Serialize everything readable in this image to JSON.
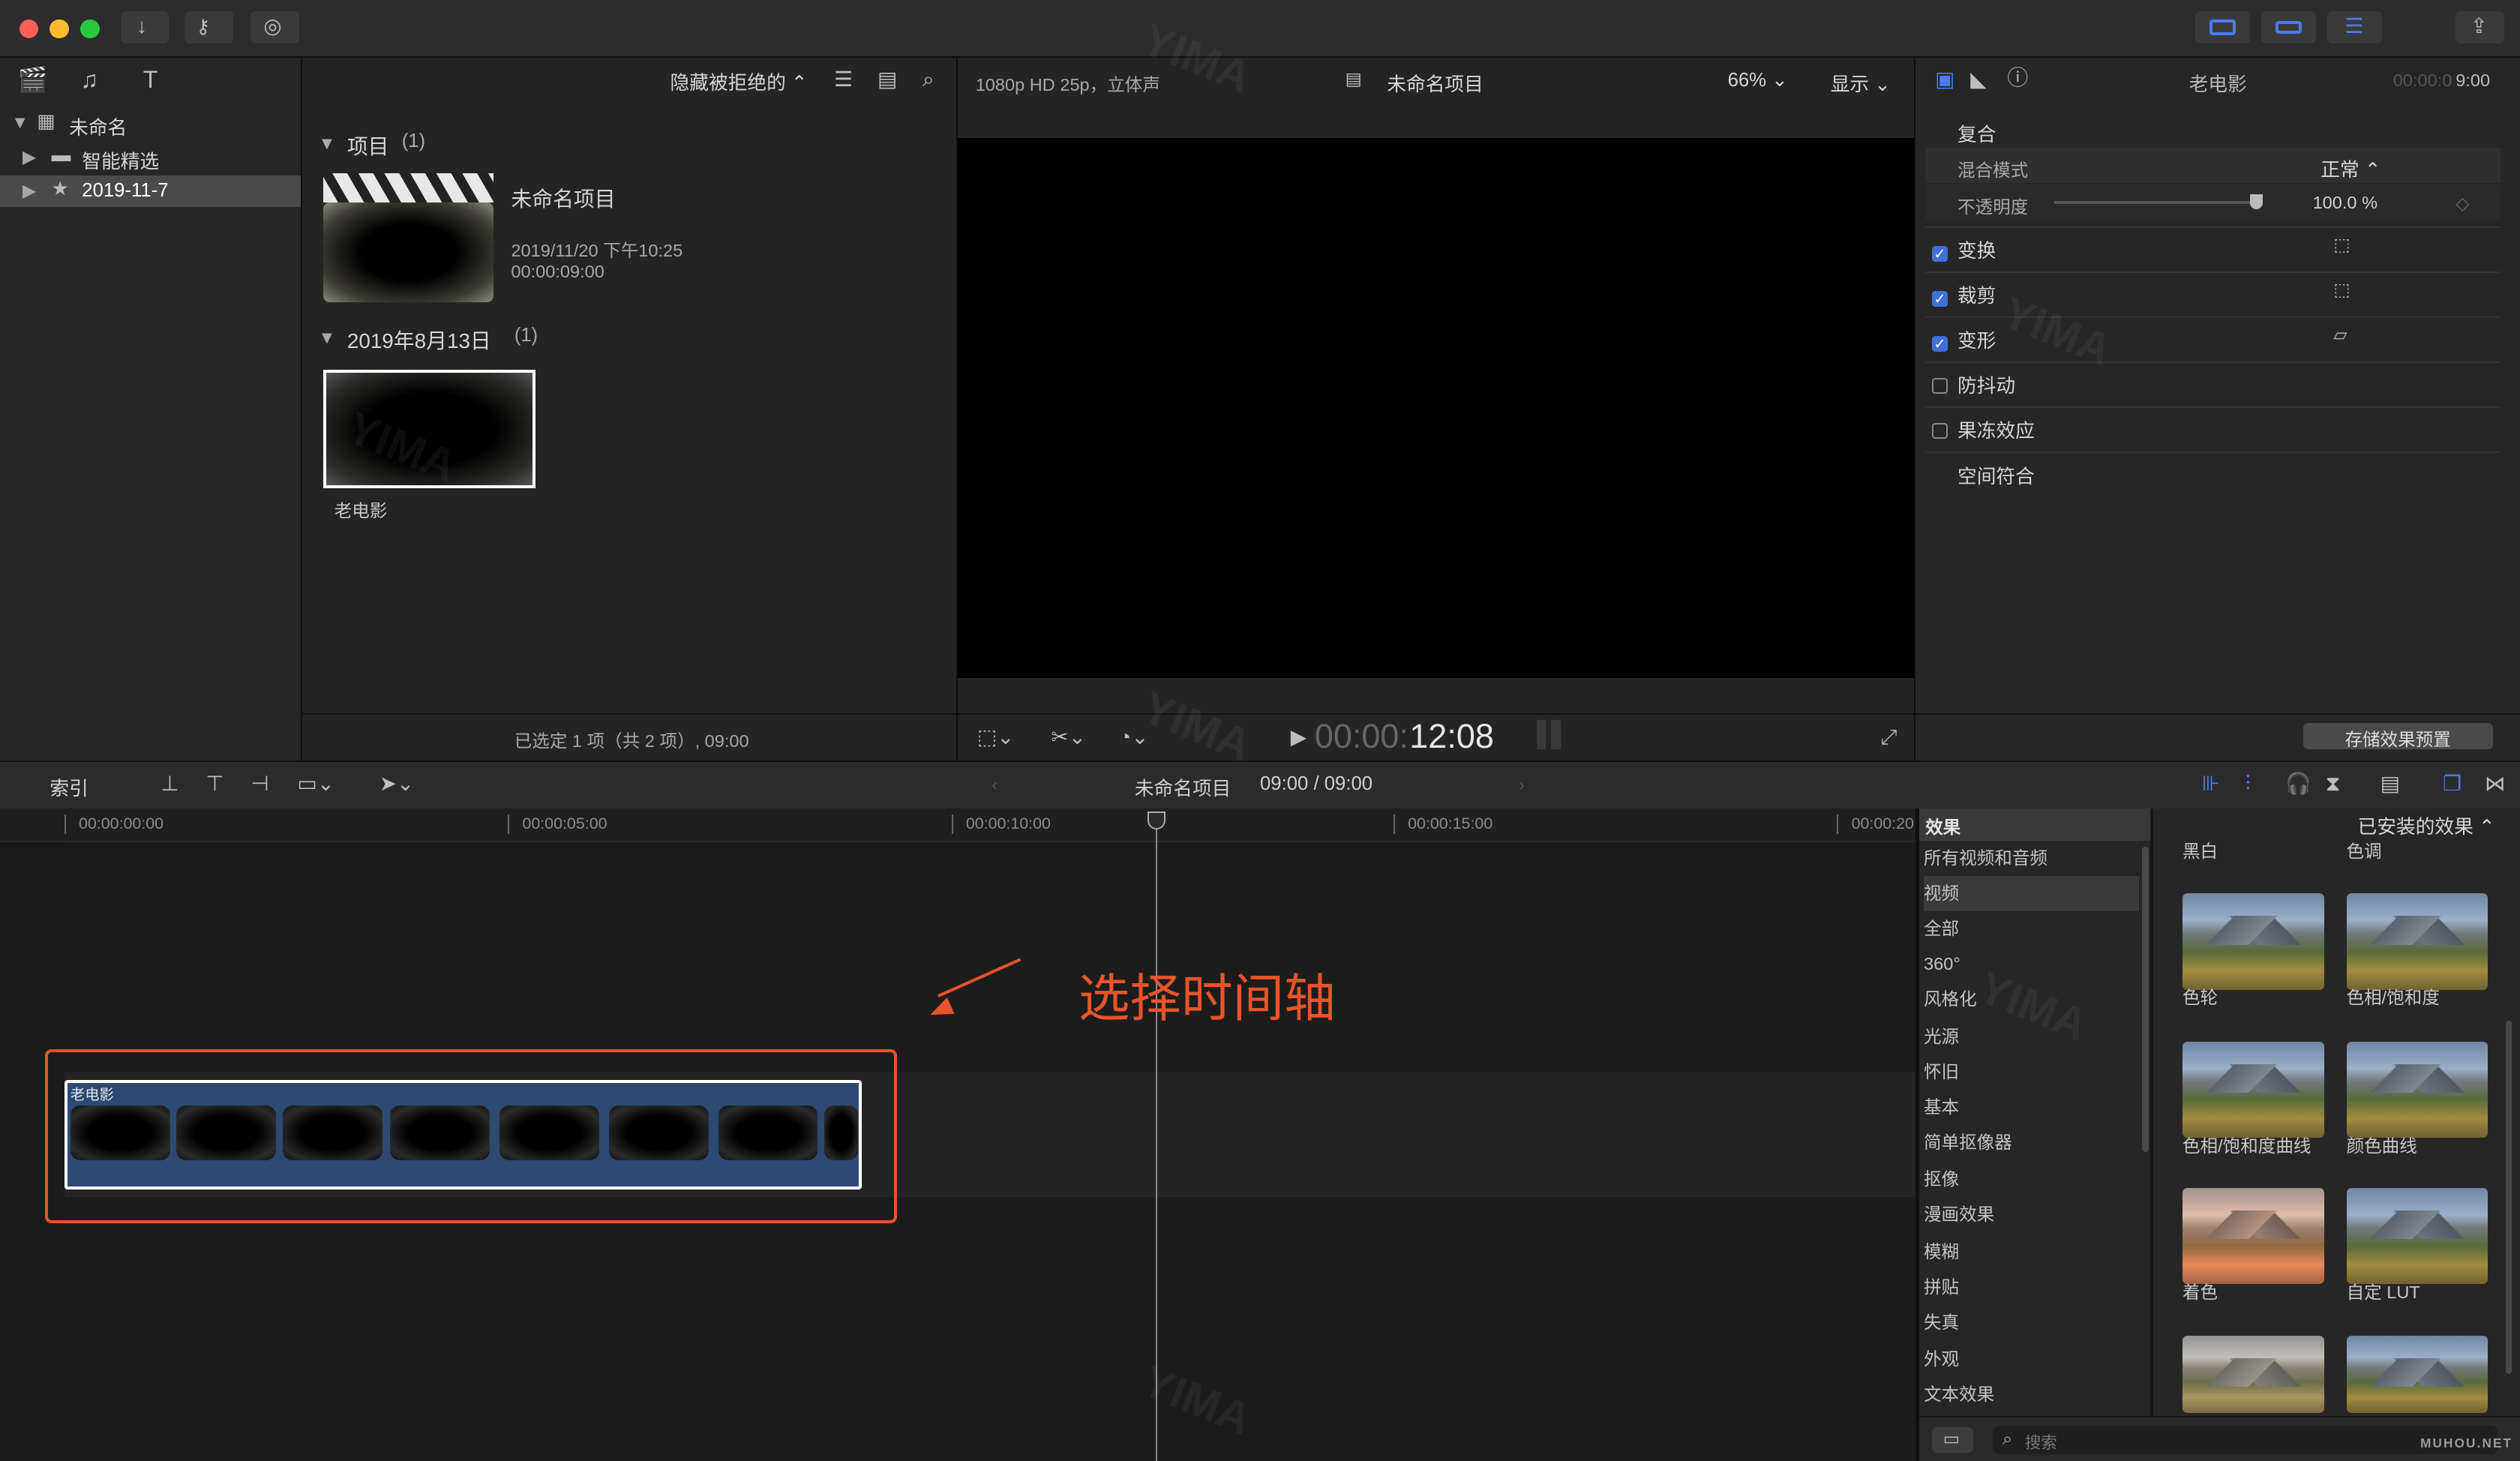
{
  "window": {
    "buttons": [
      "close",
      "minimize",
      "zoom"
    ]
  },
  "browser": {
    "library": {
      "name": "未命名",
      "items": [
        {
          "label": "智能精选"
        },
        {
          "label": "2019-11-7"
        }
      ]
    },
    "filter_label": "隐藏被拒绝的",
    "projects_header": {
      "label": "项目",
      "count": "(1)"
    },
    "project": {
      "title": "未命名项目",
      "date": "2019/11/20 下午10:25",
      "duration": "00:00:09:00"
    },
    "date_header": {
      "label": "2019年8月13日",
      "count": "(1)"
    },
    "clip": {
      "name": "老电影"
    },
    "status": "已选定 1 项（共 2 项）, 09:00"
  },
  "viewer": {
    "format": "1080p HD 25p，立体声",
    "project_name": "未命名项目",
    "zoom": "66%",
    "display_label": "显示",
    "timecode_dim": "00:00:",
    "timecode_bright": "12:08"
  },
  "inspector": {
    "title": "老电影",
    "timecode_dim": "00:00:0",
    "timecode_bright": "9:00",
    "composite_label": "复合",
    "blend_mode_label": "混合模式",
    "blend_mode_value": "正常",
    "opacity_label": "不透明度",
    "opacity_value": "100.0 %",
    "opacity_fraction": 1.0,
    "sections": [
      {
        "label": "变换",
        "checked": true
      },
      {
        "label": "裁剪",
        "checked": true
      },
      {
        "label": "变形",
        "checked": true
      },
      {
        "label": "防抖动",
        "checked": false
      },
      {
        "label": "果冻效应",
        "checked": false
      }
    ],
    "spatial_label": "空间符合",
    "save_preset": "存储效果预置"
  },
  "timeline": {
    "index_label": "索引",
    "project_name": "未命名项目",
    "duration": "09:00 / 09:00",
    "ruler": [
      "00:00:00:00",
      "00:00:05:00",
      "00:00:10:00",
      "00:00:15:00",
      "00:00:20"
    ],
    "clip_label": "老电影",
    "annotation": "选择时间轴"
  },
  "effects": {
    "title": "效果",
    "installed_label": "已安装的效果",
    "categories": [
      "所有视频和音频",
      "视频",
      "全部",
      "360°",
      "风格化",
      "光源",
      "怀旧",
      "基本",
      "简单抠像器",
      "抠像",
      "漫画效果",
      "模糊",
      "拼贴",
      "失真",
      "外观",
      "文本效果"
    ],
    "top_labels": [
      "黑白",
      "色调"
    ],
    "items": [
      "色轮",
      "色相/饱和度",
      "色相/饱和度曲线",
      "颜色曲线",
      "着色",
      "自定 LUT"
    ],
    "search_placeholder": "搜索"
  },
  "watermark": {
    "brand": "YIMA",
    "site": "MUHOU.NET"
  },
  "colors": {
    "accent": "#3f6fd8",
    "annotation": "#e8542a",
    "clip": "#2d4a72"
  }
}
